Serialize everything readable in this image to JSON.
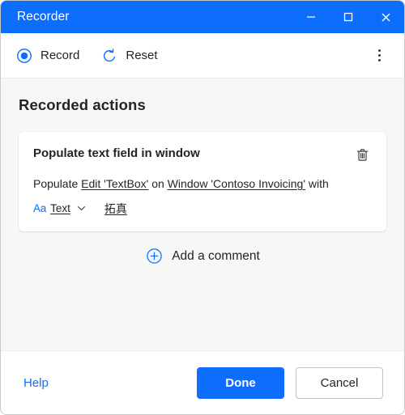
{
  "window": {
    "title": "Recorder",
    "controls": {
      "minimize": "minimize-icon",
      "maximize": "maximize-icon",
      "close": "close-icon"
    }
  },
  "toolbar": {
    "record_label": "Record",
    "record_icon": "record-radio-icon",
    "reset_label": "Reset",
    "reset_icon": "reset-arrow-icon",
    "overflow_icon": "more-vertical-icon"
  },
  "main": {
    "section_heading": "Recorded actions",
    "card": {
      "title": "Populate text field in window",
      "delete_icon": "trash-icon",
      "description": {
        "prefix": "Populate",
        "target_link": "Edit 'TextBox'",
        "middle": "on",
        "window_link": "Window 'Contoso Invoicing'",
        "suffix": "with"
      },
      "parameter": {
        "type_icon": "Aa",
        "type_label": "Text",
        "chevron_icon": "chevron-down-icon",
        "value": "拓真"
      }
    },
    "add_comment": {
      "label": "Add a comment",
      "icon": "plus-circle-icon"
    }
  },
  "footer": {
    "help_label": "Help",
    "done_label": "Done",
    "cancel_label": "Cancel"
  },
  "colors": {
    "accent": "#0d6efd",
    "titlebar": "#0d6efd",
    "body_background": "#f7f7f5",
    "card_background": "#ffffff",
    "text": "#242424"
  }
}
